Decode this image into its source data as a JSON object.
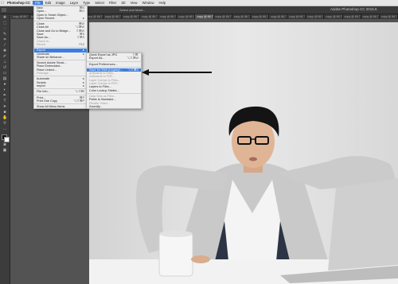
{
  "menubar": {
    "apple": "",
    "items": [
      "Photoshop CC",
      "File",
      "Edit",
      "Image",
      "Layer",
      "Type",
      "Select",
      "Filter",
      "3D",
      "View",
      "Window",
      "Help"
    ],
    "active_item": "File"
  },
  "app": {
    "title": "Adobe Photoshop CC 2015.5"
  },
  "optionsbar": {
    "items": [
      "",
      "",
      "",
      "",
      "Select and Mask..."
    ]
  },
  "tabs": [
    "copy @ 66.7% (RGB/8)",
    "copy @ 66.7% (RGB/8)",
    "copy @ 66.7% (RGB/8)",
    "copy @ 66.7% (RGB/8)",
    "copy @ 66.7% (RGB/8)",
    "copy @ 66.7% (RGB/8)",
    "copy @ 66.7% (RGB/8)",
    "copy @ 66.7% (RGB/8)",
    "copy @ 66.7% (RGB/8)",
    "copy @ 66.7% (RGB/8)",
    "copy @ 66.7% (RGB/8)",
    "copy @ 66.7% (RGB/8)",
    "copy @ 66.7% (RGB/8)",
    "copy @ 66.7% (RGB/8)",
    "copy @ 66.7% (RGB/8)",
    "copy @ 66.7% (RGB/8)",
    "copy @ 66.7% (RGB/8)",
    "copy @ 66.7% (RGB/8)",
    "copy @ 66.7% (RGB/8)",
    "copy @ 66.7% (RGB/8)",
    "copy @ 66.7% (RGB/8)"
  ],
  "file_menu": {
    "items": [
      {
        "label": "New",
        "shortcut": "⌘N"
      },
      {
        "label": "Open...",
        "shortcut": "⌘O"
      },
      {
        "label": "Open in Smart Object...",
        "shortcut": ""
      },
      {
        "label": "Open Recent",
        "shortcut": "▸"
      },
      {
        "sep": true
      },
      {
        "label": "Close",
        "shortcut": "⌘W"
      },
      {
        "label": "Close All",
        "shortcut": "⌥⌘W"
      },
      {
        "label": "Close and Go to Bridge...",
        "shortcut": "⇧⌘W"
      },
      {
        "label": "Save",
        "shortcut": "⌘S"
      },
      {
        "label": "Save As...",
        "shortcut": "⇧⌘S"
      },
      {
        "label": "Check In...",
        "shortcut": "",
        "disabled": true
      },
      {
        "label": "Revert",
        "shortcut": "F12",
        "disabled": true
      },
      {
        "sep": true
      },
      {
        "label": "Export",
        "shortcut": "▸",
        "highlight": true
      },
      {
        "label": "Generate",
        "shortcut": "▸"
      },
      {
        "label": "Share on Behance...",
        "shortcut": ""
      },
      {
        "sep": true
      },
      {
        "label": "Search Adobe Stock...",
        "shortcut": ""
      },
      {
        "label": "Place Embedded...",
        "shortcut": ""
      },
      {
        "label": "Place Linked...",
        "shortcut": ""
      },
      {
        "label": "Package...",
        "shortcut": "",
        "disabled": true
      },
      {
        "sep": true
      },
      {
        "label": "Automate",
        "shortcut": "▸"
      },
      {
        "label": "Scripts",
        "shortcut": "▸"
      },
      {
        "label": "Import",
        "shortcut": "▸"
      },
      {
        "sep": true
      },
      {
        "label": "File Info...",
        "shortcut": "⌥⇧⌘I"
      },
      {
        "sep": true
      },
      {
        "label": "Print...",
        "shortcut": "⌘P"
      },
      {
        "label": "Print One Copy",
        "shortcut": "⌥⇧⌘P"
      },
      {
        "sep": true
      },
      {
        "label": "Show All Menu Items",
        "shortcut": ""
      }
    ]
  },
  "export_submenu": {
    "items": [
      {
        "label": "Quick Export as JPG",
        "shortcut": "⇧⌘'"
      },
      {
        "label": "Export As...",
        "shortcut": "⌥⇧⌘W"
      },
      {
        "sep": true
      },
      {
        "label": "Export Preferences...",
        "shortcut": ""
      },
      {
        "sep": true
      },
      {
        "label": "Save for Web (Legacy)...",
        "shortcut": "⌥⇧⌘S",
        "highlight": true
      },
      {
        "label": "Artboards to Files...",
        "shortcut": "",
        "disabled": true
      },
      {
        "label": "Artboards to PDF...",
        "shortcut": "",
        "disabled": true
      },
      {
        "label": "Layer Comps to Files...",
        "shortcut": "",
        "disabled": true
      },
      {
        "label": "Layer Comps to PDF...",
        "shortcut": "",
        "disabled": true
      },
      {
        "label": "Layers to Files...",
        "shortcut": ""
      },
      {
        "label": "Color Lookup Tables...",
        "shortcut": ""
      },
      {
        "sep": true
      },
      {
        "label": "Data Sets as Files...",
        "shortcut": "",
        "disabled": true
      },
      {
        "label": "Paths to Illustrator...",
        "shortcut": ""
      },
      {
        "label": "Render Video...",
        "shortcut": "",
        "disabled": true
      },
      {
        "label": "Zoomify...",
        "shortcut": ""
      }
    ]
  },
  "colors": {
    "menu_highlight": "#3b7ee0",
    "ui_dark": "#535353"
  }
}
